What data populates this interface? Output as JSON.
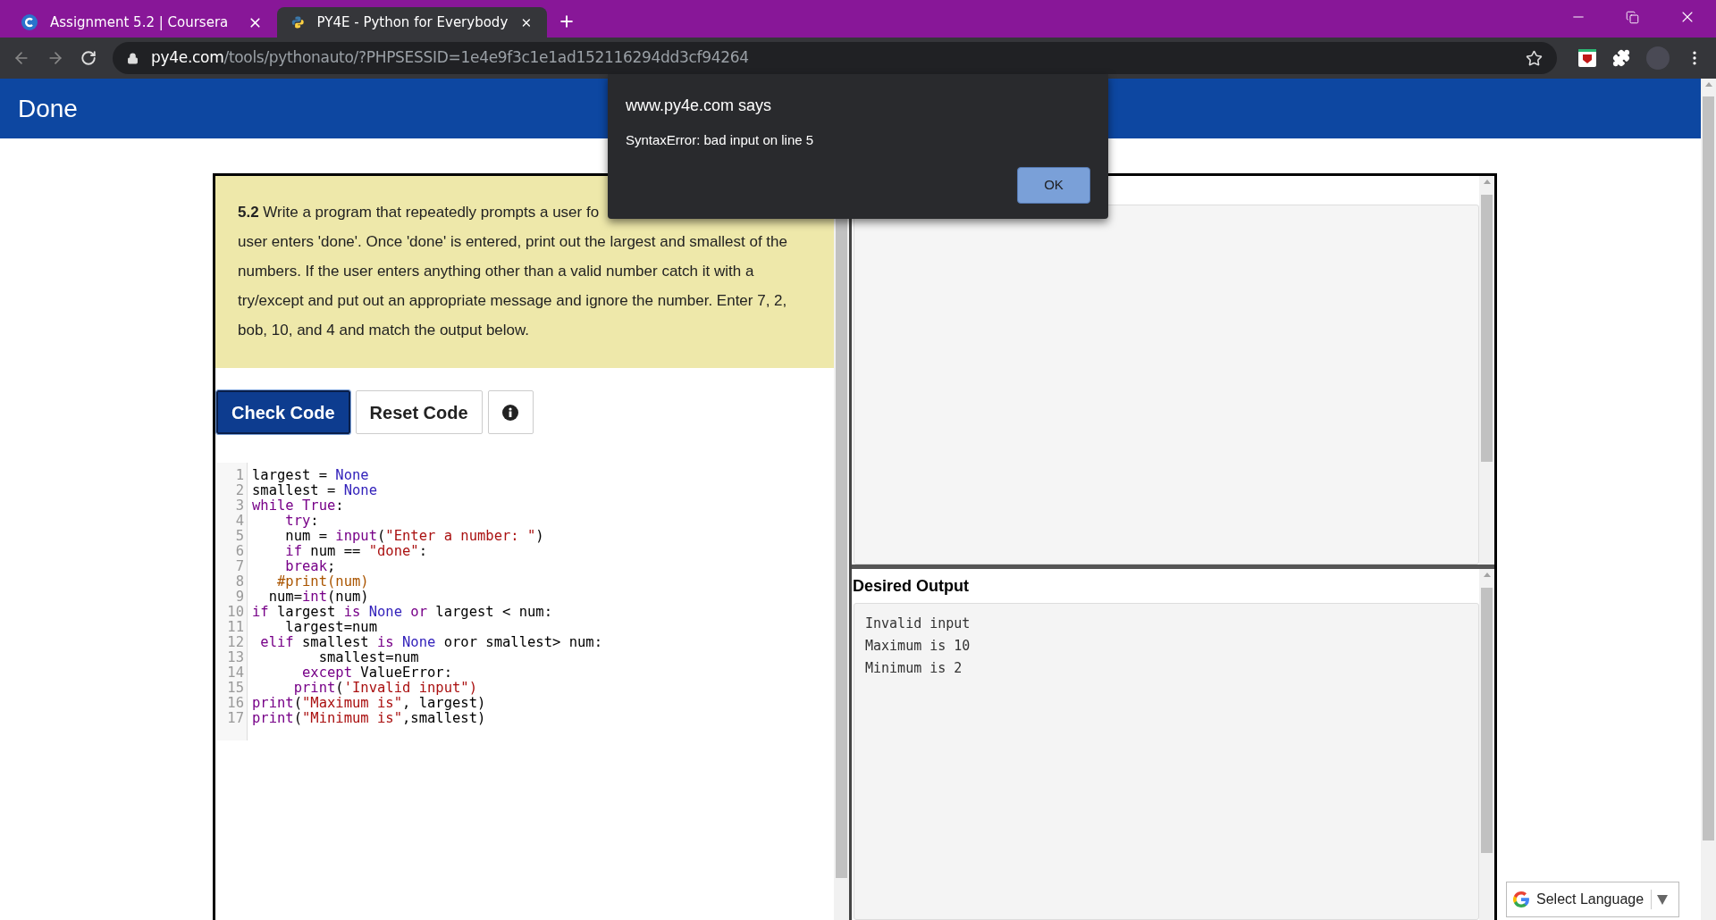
{
  "browser": {
    "tabs": [
      {
        "title": "Assignment 5.2 | Coursera",
        "selected": false
      },
      {
        "title": "PY4E - Python for Everybody",
        "selected": true
      }
    ],
    "url": {
      "host": "py4e.com",
      "path": "/tools/pythonauto/?PHPSESSID=1e4e9f3c1e1ad152116294dd3cf94264"
    }
  },
  "header": {
    "title": "Done"
  },
  "dialog": {
    "title": "www.py4e.com says",
    "message": "SyntaxError: bad input on line 5",
    "button": "OK"
  },
  "assignment": {
    "first_line": "**5.2** Write a program that repeatedly prompts a user fo",
    "rest": "user enters 'done'. Once 'done' is entered, print out the largest and smallest of the numbers. If the user enters anything other than a valid number catch it with a try/except and put out an appropriate message and ignore the number. Enter 7, 2, bob, 10, and 4 and match the output below."
  },
  "buttons": [
    {
      "label": "Check Code",
      "kind": "primary"
    },
    {
      "label": "Reset Code",
      "kind": "secondary"
    },
    {
      "kind": "info"
    }
  ],
  "code": [
    {
      "number": "1",
      "tokens": [
        {
          "kind": "plain",
          "text": "largest = "
        },
        {
          "kind": "atom",
          "text": "None"
        }
      ]
    },
    {
      "number": "2",
      "tokens": [
        {
          "kind": "plain",
          "text": "smallest = "
        },
        {
          "kind": "atom",
          "text": "None"
        }
      ]
    },
    {
      "number": "3",
      "tokens": [
        {
          "kind": "keyword",
          "text": "while True"
        },
        {
          "kind": "plain",
          "text": ":"
        }
      ]
    },
    {
      "number": "4",
      "tokens": [
        {
          "kind": "keyword",
          "text": "    try"
        },
        {
          "kind": "plain",
          "text": ":"
        }
      ]
    },
    {
      "number": "5",
      "tokens": [
        {
          "kind": "plain",
          "text": "    num = "
        },
        {
          "kind": "keyword",
          "text": "input"
        },
        {
          "kind": "plain",
          "text": "("
        },
        {
          "kind": "string",
          "text": "\"Enter a number: \""
        },
        {
          "kind": "plain",
          "text": ")"
        }
      ]
    },
    {
      "number": "6",
      "tokens": [
        {
          "kind": "keyword",
          "text": "    if"
        },
        {
          "kind": "plain",
          "text": " num == "
        },
        {
          "kind": "string",
          "text": "\"done\""
        },
        {
          "kind": "plain",
          "text": ":"
        }
      ]
    },
    {
      "number": "7",
      "tokens": [
        {
          "kind": "keyword",
          "text": "    break"
        },
        {
          "kind": "plain",
          "text": ";"
        }
      ]
    },
    {
      "number": "8",
      "tokens": [
        {
          "kind": "comment",
          "text": "   #print(num)"
        }
      ]
    },
    {
      "number": "9",
      "tokens": [
        {
          "kind": "plain",
          "text": "  num="
        },
        {
          "kind": "keyword",
          "text": "int"
        },
        {
          "kind": "plain",
          "text": "(num)"
        }
      ]
    },
    {
      "number": "10",
      "tokens": [
        {
          "kind": "keyword",
          "text": "if"
        },
        {
          "kind": "plain",
          "text": " largest "
        },
        {
          "kind": "keyword",
          "text": "is"
        },
        {
          "kind": "atom",
          "text": " None "
        },
        {
          "kind": "keyword",
          "text": "or"
        },
        {
          "kind": "plain",
          "text": " largest < num:"
        }
      ]
    },
    {
      "number": "11",
      "tokens": [
        {
          "kind": "plain",
          "text": "    largest=num"
        }
      ]
    },
    {
      "number": "12",
      "tokens": [
        {
          "kind": "keyword",
          "text": " elif"
        },
        {
          "kind": "plain",
          "text": " smallest "
        },
        {
          "kind": "keyword",
          "text": "is"
        },
        {
          "kind": "atom",
          "text": " None"
        },
        {
          "kind": "plain",
          "text": " oror smallest> num:"
        }
      ]
    },
    {
      "number": "13",
      "tokens": [
        {
          "kind": "plain",
          "text": "        smallest=num"
        }
      ]
    },
    {
      "number": "14",
      "tokens": [
        {
          "kind": "keyword",
          "text": "      except"
        },
        {
          "kind": "plain",
          "text": " ValueError:"
        }
      ]
    },
    {
      "number": "15",
      "tokens": [
        {
          "kind": "keyword",
          "text": "     print"
        },
        {
          "kind": "plain",
          "text": "("
        },
        {
          "kind": "string",
          "text": "'Invalid input\")"
        }
      ]
    },
    {
      "number": "16",
      "tokens": [
        {
          "kind": "keyword",
          "text": "print"
        },
        {
          "kind": "plain",
          "text": "("
        },
        {
          "kind": "string",
          "text": "\"Maximum is\""
        },
        {
          "kind": "plain",
          "text": ", largest)"
        }
      ]
    },
    {
      "number": "17",
      "tokens": [
        {
          "kind": "keyword",
          "text": "print"
        },
        {
          "kind": "plain",
          "text": "("
        },
        {
          "kind": "string",
          "text": "\"Minimum is\""
        },
        {
          "kind": "plain",
          "text": ",smallest)"
        }
      ]
    }
  ],
  "desired_output": {
    "heading": "Desired Output",
    "lines": [
      "Invalid input",
      "Maximum is 10",
      "Minimum is 2"
    ]
  },
  "language": {
    "label": "Select Language"
  }
}
